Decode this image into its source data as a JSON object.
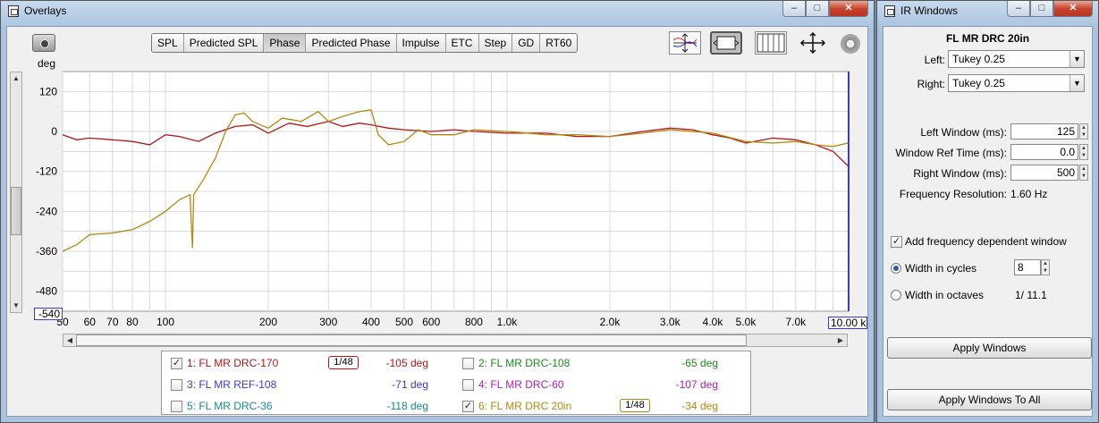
{
  "overlays": {
    "title": "Overlays",
    "window_buttons": [
      "–",
      "□",
      "✕"
    ],
    "tabs": [
      {
        "label": "SPL",
        "active": false
      },
      {
        "label": "Predicted SPL",
        "active": false
      },
      {
        "label": "Phase",
        "active": true
      },
      {
        "label": "Predicted Phase",
        "active": false
      },
      {
        "label": "Impulse",
        "active": false
      },
      {
        "label": "ETC",
        "active": false
      },
      {
        "label": "Step",
        "active": false
      },
      {
        "label": "GD",
        "active": false
      },
      {
        "label": "RT60",
        "active": false
      }
    ],
    "y_unit": "deg",
    "y_min_box": "-540",
    "x_max_box": "10.00 k",
    "legend": [
      {
        "label": "1: FL MR DRC-170",
        "checked": true,
        "value": "-105 deg",
        "color": "#b01818",
        "smoothing": "1/48"
      },
      {
        "label": "2: FL MR DRC-108",
        "checked": false,
        "value": "-65 deg",
        "color": "#1f8a1f"
      },
      {
        "label": "3: FL MR REF-108",
        "checked": false,
        "value": "-71 deg",
        "color": "#3b3bc8"
      },
      {
        "label": "4: FL MR DRC-60",
        "checked": false,
        "value": "-107 deg",
        "color": "#b021b0"
      },
      {
        "label": "5: FL MR DRC-36",
        "checked": false,
        "value": "-118 deg",
        "color": "#1a8a8a"
      },
      {
        "label": "6: FL MR DRC 20in",
        "checked": true,
        "value": "-34 deg",
        "color": "#b08a10",
        "smoothing": "1/48"
      }
    ]
  },
  "chart_data": {
    "type": "line",
    "xscale": "log",
    "xlim": [
      50,
      10000
    ],
    "ylim": [
      -540,
      180
    ],
    "ylabel": "deg",
    "yticks": [
      120,
      0,
      -120,
      -240,
      -360,
      -480
    ],
    "xticks": [
      {
        "v": 50,
        "label": "50"
      },
      {
        "v": 60,
        "label": "60"
      },
      {
        "v": 70,
        "label": "70"
      },
      {
        "v": 80,
        "label": "80"
      },
      {
        "v": 100,
        "label": "100"
      },
      {
        "v": 200,
        "label": "200"
      },
      {
        "v": 300,
        "label": "300"
      },
      {
        "v": 400,
        "label": "400"
      },
      {
        "v": 500,
        "label": "500"
      },
      {
        "v": 600,
        "label": "600"
      },
      {
        "v": 800,
        "label": "800"
      },
      {
        "v": 1000,
        "label": "1.0k"
      },
      {
        "v": 2000,
        "label": "2.0k"
      },
      {
        "v": 3000,
        "label": "3.0k"
      },
      {
        "v": 4000,
        "label": "4.0k"
      },
      {
        "v": 5000,
        "label": "5.0k"
      },
      {
        "v": 7000,
        "label": "7.0k"
      },
      {
        "v": 9000,
        "label": "10"
      }
    ],
    "series": [
      {
        "name": "1: FL MR DRC-170",
        "color": "#b01818",
        "points": [
          [
            50,
            -10
          ],
          [
            55,
            -25
          ],
          [
            60,
            -20
          ],
          [
            70,
            -25
          ],
          [
            80,
            -30
          ],
          [
            90,
            -40
          ],
          [
            100,
            -10
          ],
          [
            110,
            -15
          ],
          [
            125,
            -30
          ],
          [
            140,
            -5
          ],
          [
            160,
            15
          ],
          [
            180,
            20
          ],
          [
            200,
            -5
          ],
          [
            230,
            25
          ],
          [
            260,
            15
          ],
          [
            300,
            30
          ],
          [
            330,
            15
          ],
          [
            370,
            25
          ],
          [
            400,
            20
          ],
          [
            450,
            10
          ],
          [
            500,
            5
          ],
          [
            600,
            0
          ],
          [
            700,
            5
          ],
          [
            800,
            0
          ],
          [
            1000,
            -5
          ],
          [
            1300,
            -5
          ],
          [
            1600,
            -15
          ],
          [
            2000,
            -15
          ],
          [
            2500,
            0
          ],
          [
            3000,
            10
          ],
          [
            3500,
            5
          ],
          [
            4000,
            -10
          ],
          [
            4500,
            -20
          ],
          [
            5000,
            -35
          ],
          [
            6000,
            -20
          ],
          [
            7000,
            -25
          ],
          [
            8000,
            -40
          ],
          [
            9000,
            -60
          ],
          [
            10000,
            -105
          ]
        ]
      },
      {
        "name": "6: FL MR DRC 20in",
        "color": "#b08a10",
        "points": [
          [
            50,
            -360
          ],
          [
            55,
            -340
          ],
          [
            60,
            -310
          ],
          [
            70,
            -305
          ],
          [
            80,
            -295
          ],
          [
            90,
            -270
          ],
          [
            100,
            -240
          ],
          [
            110,
            -205
          ],
          [
            118,
            -190
          ],
          [
            120,
            -350
          ],
          [
            121,
            -190
          ],
          [
            130,
            -140
          ],
          [
            140,
            -80
          ],
          [
            150,
            0
          ],
          [
            160,
            50
          ],
          [
            170,
            55
          ],
          [
            180,
            30
          ],
          [
            200,
            10
          ],
          [
            220,
            40
          ],
          [
            250,
            30
          ],
          [
            280,
            60
          ],
          [
            300,
            30
          ],
          [
            330,
            45
          ],
          [
            370,
            60
          ],
          [
            400,
            65
          ],
          [
            420,
            -10
          ],
          [
            450,
            -40
          ],
          [
            500,
            -30
          ],
          [
            550,
            5
          ],
          [
            600,
            -10
          ],
          [
            700,
            -10
          ],
          [
            800,
            5
          ],
          [
            1000,
            0
          ],
          [
            1300,
            -10
          ],
          [
            1600,
            -10
          ],
          [
            2000,
            -15
          ],
          [
            2500,
            -5
          ],
          [
            3000,
            5
          ],
          [
            3500,
            0
          ],
          [
            4000,
            -5
          ],
          [
            5000,
            -30
          ],
          [
            6000,
            -35
          ],
          [
            7000,
            -30
          ],
          [
            8000,
            -40
          ],
          [
            9000,
            -45
          ],
          [
            10000,
            -34
          ]
        ]
      }
    ]
  },
  "ir": {
    "title": "IR Windows",
    "window_buttons": [
      "–",
      "□",
      "✕"
    ],
    "measurement": "FL MR DRC 20in",
    "left_label": "Left:",
    "left_value": "Tukey 0.25",
    "right_label": "Right:",
    "right_value": "Tukey 0.25",
    "left_window_label": "Left Window (ms):",
    "left_window_value": "125",
    "ref_time_label": "Window Ref Time (ms):",
    "ref_time_value": "0.0",
    "right_window_label": "Right Window (ms):",
    "right_window_value": "500",
    "freq_res_label": "Frequency Resolution:",
    "freq_res_value": "1.60 Hz",
    "add_fdw_label": "Add frequency dependent window",
    "add_fdw_checked": true,
    "cycles_label": "Width in cycles",
    "cycles_value": "8",
    "octaves_label": "Width in octaves",
    "octaves_value": "1/ 11.1",
    "apply_label": "Apply Windows",
    "apply_all_label": "Apply Windows To All"
  }
}
